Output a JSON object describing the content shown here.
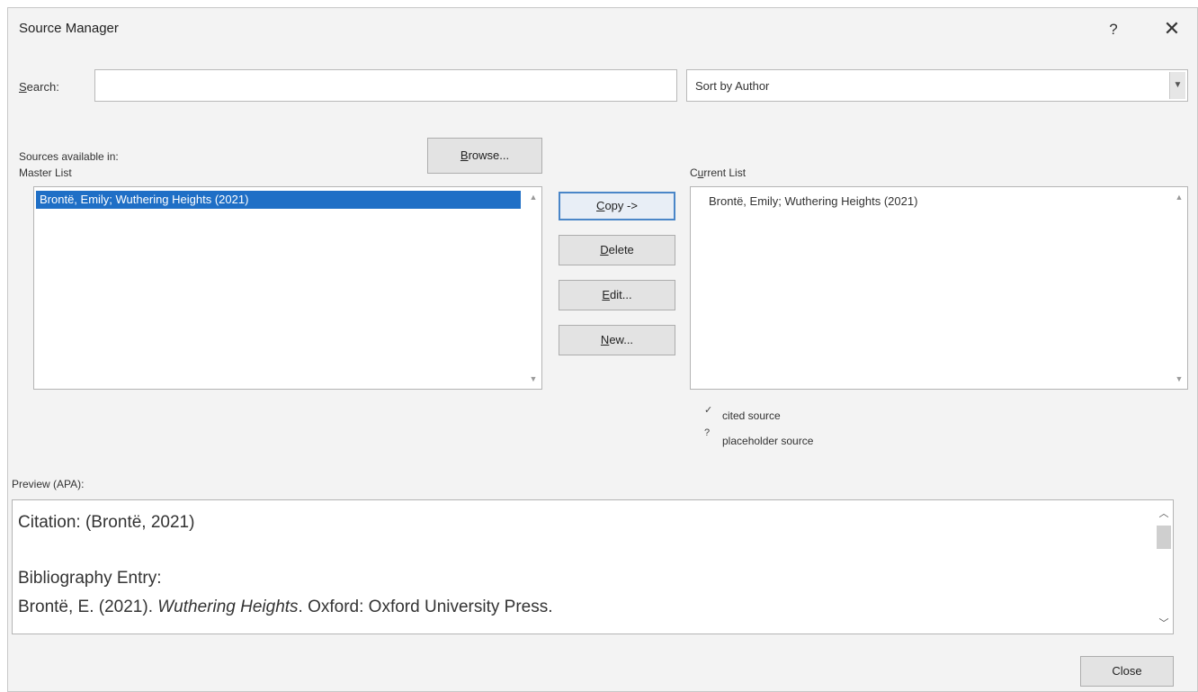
{
  "dialog": {
    "title": "Source Manager",
    "help_glyph": "?",
    "close_glyph": "✕"
  },
  "search": {
    "label_first": "S",
    "label_rest": "earch:",
    "value": "",
    "placeholder": ""
  },
  "sort": {
    "selected": "Sort by Author",
    "arrow": "▼"
  },
  "master": {
    "sources_label": "Sources available in:",
    "list_label": "Master List",
    "browse_first": "B",
    "browse_rest": "rowse...",
    "items": [
      "Brontë, Emily; Wuthering Heights (2021)"
    ]
  },
  "actions": {
    "copy_first": "C",
    "copy_rest": "opy ->",
    "delete_first": "D",
    "delete_rest": "elete",
    "edit_first": "E",
    "edit_rest": "dit...",
    "new_first": "N",
    "new_rest": "ew..."
  },
  "current": {
    "label_first": "C",
    "label_mid": "u",
    "label_rest": "rrent List",
    "items": [
      "Brontë, Emily; Wuthering Heights (2021)"
    ]
  },
  "legend": {
    "cited_mark": "✓",
    "cited_label": "cited source",
    "placeholder_mark": "?",
    "placeholder_label": "placeholder source"
  },
  "preview": {
    "label": "Preview (APA):",
    "citation": "Citation: (Brontë, 2021)",
    "bib_heading": "Bibliography Entry:",
    "bib_author": "Brontë, E. (2021). ",
    "bib_title": "Wuthering Heights",
    "bib_rest": ". Oxford: Oxford University Press."
  },
  "footer": {
    "close_label": "Close"
  }
}
